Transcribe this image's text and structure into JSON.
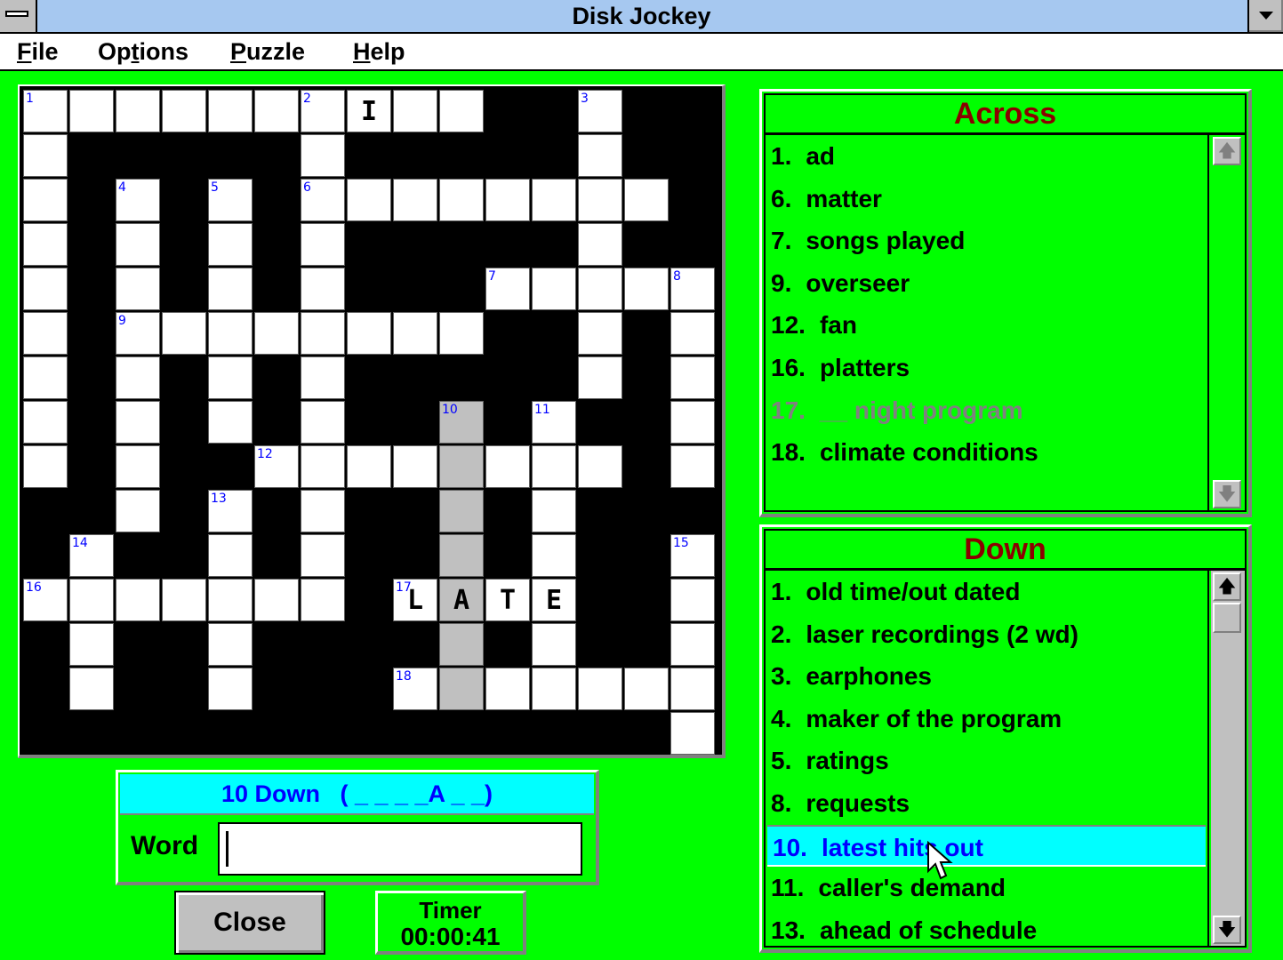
{
  "window": {
    "title": "Disk Jockey",
    "system_menu_icon": "system-menu-icon",
    "minimize_icon": "minimize-arrow-icon"
  },
  "menubar": {
    "items": [
      {
        "label": "File",
        "mnemonic_index": 0
      },
      {
        "label": "Options",
        "mnemonic_index": 2
      },
      {
        "label": "Puzzle",
        "mnemonic_index": 0
      },
      {
        "label": "Help",
        "mnemonic_index": 0
      }
    ]
  },
  "grid": {
    "rows": 15,
    "cols": 15,
    "layout": [
      "WWWWWWWWWWBBWBB",
      "WBBBBBWBBBBBWBB",
      "WBWBWBWWWWWWWWB",
      "WBWBWBWBBBBBWBB",
      "WBWBWBWBBBWWWWW",
      "WBWWWWWWWWBBWBW",
      "WBWBWBWBBBBBWBW",
      "WBWBWBWBBGBWBBW",
      "WBWBBWWWWGWWWBW",
      "BBWBWBWBBGBWBBB",
      "BWBBWBWBBGBWBBW",
      "WWWWWWWBWGWWBBW",
      "BWBBWBBBBGBWBBW",
      "BWBBWBBBWGWWWWW",
      "BBBBBBBBBBBBBBW"
    ],
    "numbers": [
      {
        "r": 0,
        "c": 0,
        "n": "1"
      },
      {
        "r": 0,
        "c": 6,
        "n": "2"
      },
      {
        "r": 0,
        "c": 12,
        "n": "3"
      },
      {
        "r": 2,
        "c": 2,
        "n": "4"
      },
      {
        "r": 2,
        "c": 4,
        "n": "5"
      },
      {
        "r": 2,
        "c": 6,
        "n": "6"
      },
      {
        "r": 4,
        "c": 10,
        "n": "7"
      },
      {
        "r": 4,
        "c": 14,
        "n": "8"
      },
      {
        "r": 5,
        "c": 2,
        "n": "9"
      },
      {
        "r": 7,
        "c": 9,
        "n": "10"
      },
      {
        "r": 7,
        "c": 11,
        "n": "11"
      },
      {
        "r": 8,
        "c": 5,
        "n": "12"
      },
      {
        "r": 9,
        "c": 4,
        "n": "13"
      },
      {
        "r": 10,
        "c": 1,
        "n": "14"
      },
      {
        "r": 10,
        "c": 14,
        "n": "15"
      },
      {
        "r": 11,
        "c": 0,
        "n": "16"
      },
      {
        "r": 11,
        "c": 8,
        "n": "17"
      },
      {
        "r": 13,
        "c": 8,
        "n": "18"
      }
    ],
    "letters": [
      {
        "r": 0,
        "c": 7,
        "ch": "I"
      },
      {
        "r": 11,
        "c": 8,
        "ch": "L"
      },
      {
        "r": 11,
        "c": 9,
        "ch": "A"
      },
      {
        "r": 11,
        "c": 10,
        "ch": "T"
      },
      {
        "r": 11,
        "c": 11,
        "ch": "E"
      }
    ],
    "highlighted_word": "10 Down"
  },
  "across": {
    "header": "Across",
    "clues": [
      {
        "num": "1.",
        "text": "ad",
        "state": "normal"
      },
      {
        "num": "6.",
        "text": "matter",
        "state": "normal"
      },
      {
        "num": "7.",
        "text": "songs played",
        "state": "normal"
      },
      {
        "num": "9.",
        "text": "overseer",
        "state": "normal"
      },
      {
        "num": "12.",
        "text": "fan",
        "state": "normal"
      },
      {
        "num": "16.",
        "text": "platters",
        "state": "normal"
      },
      {
        "num": "17.",
        "text": "__ night program",
        "state": "solved"
      },
      {
        "num": "18.",
        "text": "climate conditions",
        "state": "normal"
      }
    ],
    "scroll_up_icon": "scroll-up-arrow-icon",
    "scroll_down_icon": "scroll-down-arrow-icon"
  },
  "down": {
    "header": "Down",
    "clues": [
      {
        "num": "1.",
        "text": "old time/out dated",
        "state": "normal"
      },
      {
        "num": "2.",
        "text": "laser recordings (2 wd)",
        "state": "normal"
      },
      {
        "num": "3.",
        "text": "earphones",
        "state": "normal"
      },
      {
        "num": "4.",
        "text": "maker of the program",
        "state": "normal"
      },
      {
        "num": "5.",
        "text": "ratings",
        "state": "normal"
      },
      {
        "num": "8.",
        "text": "requests",
        "state": "normal"
      },
      {
        "num": "10.",
        "text": "latest hits out",
        "state": "selected"
      },
      {
        "num": "11.",
        "text": "caller's demand",
        "state": "normal"
      },
      {
        "num": "13.",
        "text": "ahead of schedule",
        "state": "normal"
      }
    ],
    "scroll_up_icon": "scroll-up-arrow-icon",
    "scroll_down_icon": "scroll-down-arrow-icon",
    "scroll_position": 0
  },
  "entry": {
    "header": "10 Down   ( _ _ _ _A _ _)",
    "word_label": "Word",
    "word_value": "",
    "word_placeholder": ""
  },
  "buttons": {
    "close_label": "Close"
  },
  "timer": {
    "label": "Timer",
    "value": "00:00:41"
  },
  "colors": {
    "background": "#00ff00",
    "title_bar": "#a6c8f0",
    "header_text": "#8b0000",
    "number_blue": "#0000ff",
    "highlight_cyan": "#00ffff",
    "highlight_gray": "#c0c0c0",
    "solved_gray": "#808080"
  }
}
